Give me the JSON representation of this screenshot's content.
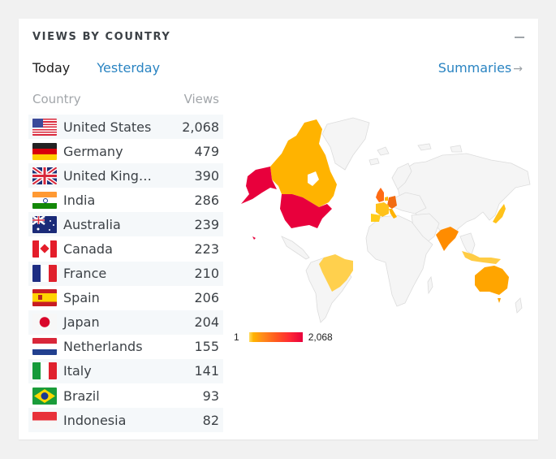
{
  "card": {
    "title": "VIEWS BY COUNTRY",
    "collapse_icon": "minus-icon"
  },
  "tabs": [
    {
      "label": "Today",
      "active": true
    },
    {
      "label": "Yesterday",
      "active": false
    }
  ],
  "summaries": {
    "label": "Summaries",
    "arrow": "→"
  },
  "table": {
    "headers": {
      "country": "Country",
      "views": "Views"
    },
    "rows": [
      {
        "flag": "us-flag-icon",
        "country": "United States",
        "views": "2,068"
      },
      {
        "flag": "de-flag-icon",
        "country": "Germany",
        "views": "479"
      },
      {
        "flag": "gb-flag-icon",
        "country": "United King…",
        "views": "390"
      },
      {
        "flag": "in-flag-icon",
        "country": "India",
        "views": "286"
      },
      {
        "flag": "au-flag-icon",
        "country": "Australia",
        "views": "239"
      },
      {
        "flag": "ca-flag-icon",
        "country": "Canada",
        "views": "223"
      },
      {
        "flag": "fr-flag-icon",
        "country": "France",
        "views": "210"
      },
      {
        "flag": "es-flag-icon",
        "country": "Spain",
        "views": "206"
      },
      {
        "flag": "jp-flag-icon",
        "country": "Japan",
        "views": "204"
      },
      {
        "flag": "nl-flag-icon",
        "country": "Netherlands",
        "views": "155"
      },
      {
        "flag": "it-flag-icon",
        "country": "Italy",
        "views": "141"
      },
      {
        "flag": "br-flag-icon",
        "country": "Brazil",
        "views": "93"
      },
      {
        "flag": "id-flag-icon",
        "country": "Indonesia",
        "views": "82"
      }
    ]
  },
  "map": {
    "legend_min": "1",
    "legend_max": "2,068",
    "colors": {
      "low": "#ffdd66",
      "mid": "#ffb300",
      "high": "#ff6a13",
      "max": "#e8003c",
      "empty": "#f5f5f5",
      "border": "#dddddd"
    }
  }
}
